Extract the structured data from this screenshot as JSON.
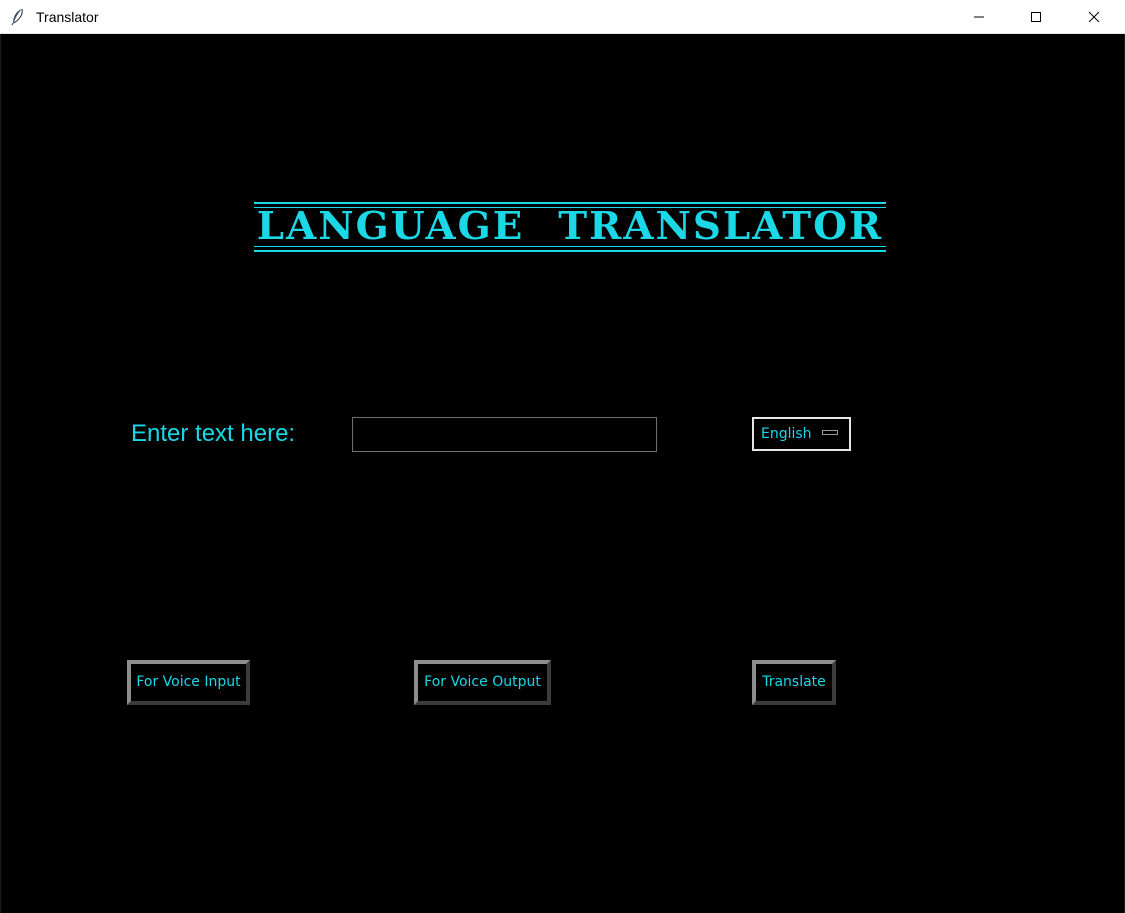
{
  "window": {
    "title": "Translator"
  },
  "heading": {
    "text": "LANGUAGE  TRANSLATOR"
  },
  "input": {
    "label": "Enter text here:",
    "value": "",
    "placeholder": ""
  },
  "language": {
    "selected": "English"
  },
  "buttons": {
    "voice_input": "For Voice Input",
    "voice_output": "For Voice Output",
    "translate": "Translate"
  },
  "colors": {
    "accent": "#1ad8e6",
    "background": "#000000"
  },
  "icons": {
    "app": "feather-icon",
    "minimize": "minimize-icon",
    "maximize": "maximize-icon",
    "close": "close-icon"
  }
}
